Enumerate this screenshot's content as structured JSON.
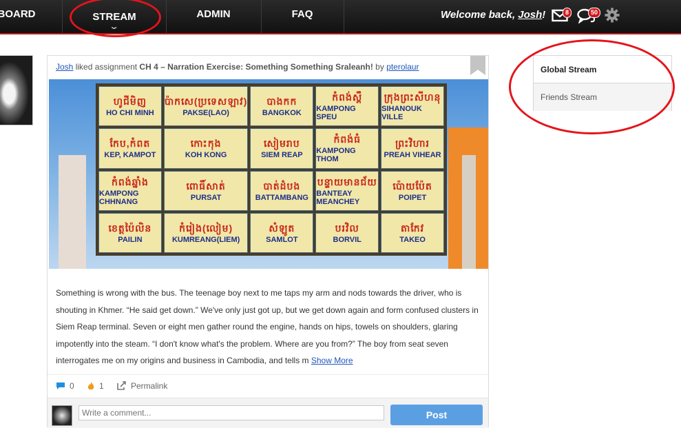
{
  "nav": {
    "dashboard": "BOARD",
    "stream": "STREAM",
    "stream_chevron": "⌄",
    "admin": "ADMIN",
    "faq": "FAQ",
    "welcome_prefix": "Welcome back, ",
    "user": "Josh",
    "welcome_suffix": "!",
    "mail_count": "8",
    "chat_count": "50"
  },
  "post": {
    "actor": "Josh",
    "verb": " liked assignment ",
    "assignment": "CH 4 – Narration Exercise: Something Something Sraleanh!",
    "by": " by ",
    "author": "pterolaur",
    "body": "Something is wrong with the bus. The teenage boy next to me taps my arm and nods towards the driver, who is shouting in Khmer. “He said get down.” We've only just got up, but we get down again and form confused clusters in Siem Reap terminal. Seven or eight men gather round the engine, hands on hips, towels on shoulders, glaring impotently into the steam. “I don't know what's the problem. Where are you from?” The boy from seat seven interrogates me on my origins and business in Cambodia, and tells m ",
    "show_more": "Show More",
    "comments_count": "0",
    "likes_count": "1",
    "permalink": "Permalink",
    "comment_placeholder": "Write a comment...",
    "post_button": "Post"
  },
  "signs": [
    {
      "khmer": "ហូជីមិញ",
      "latin": "HO CHI MINH"
    },
    {
      "khmer": "ប៉ាកសេ(ប្រទេសឡាវ)",
      "latin": "PAKSE(LAO)"
    },
    {
      "khmer": "បាងកក",
      "latin": "BANGKOK"
    },
    {
      "khmer": "កំពង់ស្ពឺ",
      "latin": "KAMPONG SPEU"
    },
    {
      "khmer": "ក្រុងព្រះសីហនុ",
      "latin": "SIHANOUK VILLE"
    },
    {
      "khmer": "កែប,កំពត",
      "latin": "KEP, KAMPOT"
    },
    {
      "khmer": "កោះកុង",
      "latin": "KOH KONG"
    },
    {
      "khmer": "សៀមរាប",
      "latin": "SIEM REAP"
    },
    {
      "khmer": "កំពង់ធំ",
      "latin": "KAMPONG THOM"
    },
    {
      "khmer": "ព្រះវិហារ",
      "latin": "PREAH VIHEAR"
    },
    {
      "khmer": "កំពង់ឆ្នាំង",
      "latin": "KAMPONG CHHNANG"
    },
    {
      "khmer": "ពោធិ៍សាត់",
      "latin": "PURSAT"
    },
    {
      "khmer": "បាត់ដំបង",
      "latin": "BATTAMBANG"
    },
    {
      "khmer": "បន្ទាយមានជ័យ",
      "latin": "BANTEAY MEANCHEY"
    },
    {
      "khmer": "ប៉ោយប៉ែត",
      "latin": "POIPET"
    },
    {
      "khmer": "ខេត្តប៉ៃលិន",
      "latin": "PAILIN"
    },
    {
      "khmer": "កំរៀង(លៀម)",
      "latin": "KUMREANG(LIEM)"
    },
    {
      "khmer": "សំឡូត",
      "latin": "SAMLOT"
    },
    {
      "khmer": "បរវិល",
      "latin": "BORVIL"
    },
    {
      "khmer": "តាកែវ",
      "latin": "TAKEO"
    }
  ],
  "streams": {
    "global": "Global Stream",
    "friends": "Friends Stream"
  },
  "colors": {
    "nav_bg": "#111111",
    "nav_underline": "#c21a1a",
    "link": "#1f57b8",
    "annotation_red": "#e4141b",
    "post_button": "#5b9fe3"
  }
}
